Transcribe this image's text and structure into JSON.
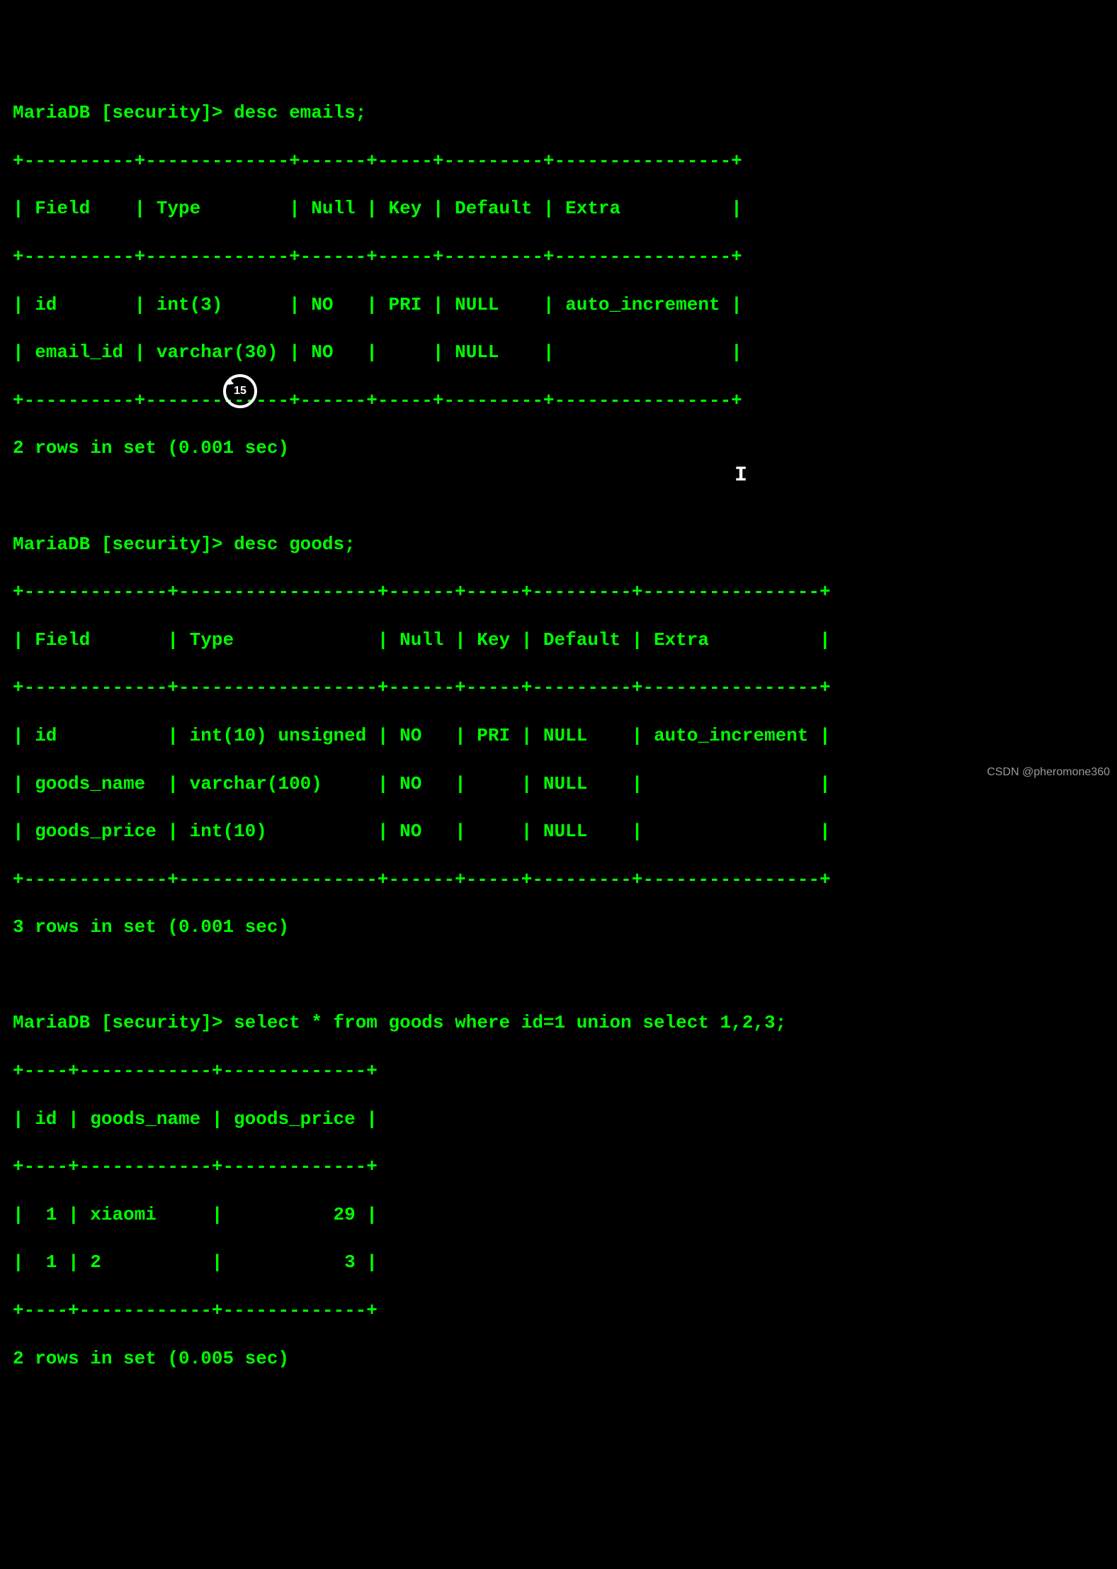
{
  "prompt": "MariaDB [security]>",
  "cmd1": "desc emails;",
  "table1": {
    "border_top": "+----------+-------------+------+-----+---------+----------------+",
    "header": "| Field    | Type        | Null | Key | Default | Extra          |",
    "border_mid": "+----------+-------------+------+-----+---------+----------------+",
    "row1": "| id       | int(3)      | NO   | PRI | NULL    | auto_increment |",
    "row2": "| email_id | varchar(30) | NO   |     | NULL    |                |",
    "border_bot": "+----------+-------------+------+-----+---------+----------------+"
  },
  "result1": "2 rows in set (0.001 sec)",
  "cmd2": "desc goods;",
  "table2": {
    "border_top": "+-------------+------------------+------+-----+---------+----------------+",
    "header": "| Field       | Type             | Null | Key | Default | Extra          |",
    "border_mid": "+-------------+------------------+------+-----+---------+----------------+",
    "row1": "| id          | int(10) unsigned | NO   | PRI | NULL    | auto_increment |",
    "row2": "| goods_name  | varchar(100)     | NO   |     | NULL    |                |",
    "row3": "| goods_price | int(10)          | NO   |     | NULL    |                |",
    "border_bot": "+-------------+------------------+------+-----+---------+----------------+"
  },
  "result2": "3 rows in set (0.001 sec)",
  "cmd3": "select * from goods where id=1 union select 1,2,3;",
  "table3": {
    "border_top": "+----+------------+-------------+",
    "header": "| id | goods_name | goods_price |",
    "border_mid": "+----+------------+-------------+",
    "row1": "|  1 | xiaomi     |          29 |",
    "row2": "|  1 | 2          |           3 |",
    "border_bot": "+----+------------+-------------+"
  },
  "result3": "2 rows in set (0.005 sec)",
  "rewind_label": "15",
  "watermark": "CSDN @pheromone360"
}
